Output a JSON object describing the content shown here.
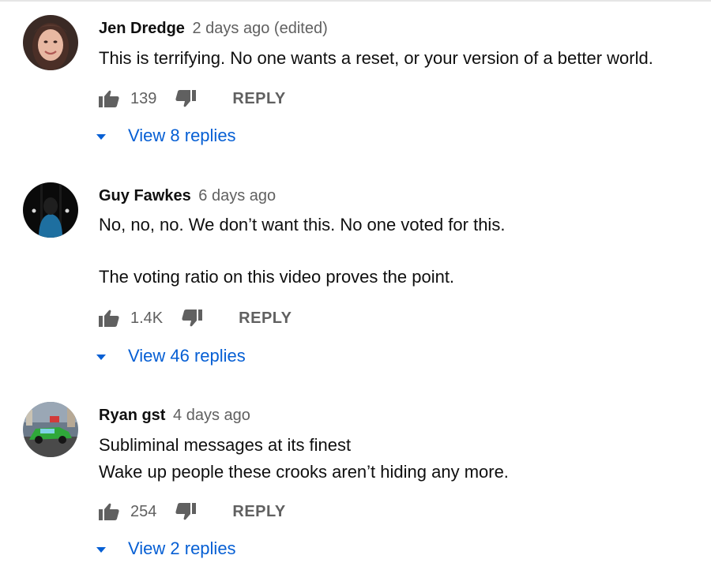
{
  "colors": {
    "link_blue": "#065fd4",
    "meta_gray": "#606060",
    "text": "#0f0f0f"
  },
  "comments": [
    {
      "avatar_icon": "avatar-woman-photo",
      "author": "Jen Dredge",
      "time": "2 days ago",
      "edited": "(edited)",
      "lines": [
        "This is terrifying. No one wants a reset, or your version of a better world."
      ],
      "likes": "139",
      "reply_label": "REPLY",
      "view_replies": "View 8 replies"
    },
    {
      "avatar_icon": "avatar-masked-figure",
      "author": "Guy Fawkes",
      "time": "6 days ago",
      "edited": "",
      "lines": [
        "No, no, no. We don’t want this. No one voted for this.",
        "The voting ratio on this video proves the point."
      ],
      "likes": "1.4K",
      "reply_label": "REPLY",
      "view_replies": "View 46 replies"
    },
    {
      "avatar_icon": "avatar-green-car",
      "author": "Ryan gst",
      "time": "4 days ago",
      "edited": "",
      "lines": [
        "Subliminal messages at its finest",
        "Wake up people these crooks aren’t hiding any more."
      ],
      "likes": "254",
      "reply_label": "REPLY",
      "view_replies": "View 2 replies"
    }
  ]
}
